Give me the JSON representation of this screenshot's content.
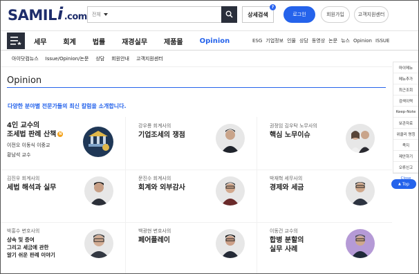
{
  "header": {
    "logo_main": "SAMIL",
    "logo_i": "i",
    "logo_dot": ".com",
    "search": {
      "category": "전체",
      "value": ""
    },
    "advanced_search": "상세검색",
    "advanced_badge": "?",
    "login": "로그인",
    "join": "회원가입",
    "customer_center": "고객지원센터"
  },
  "nav": {
    "main": [
      "세무",
      "회계",
      "법률",
      "재경실무",
      "제품몰",
      "Opinion"
    ],
    "active": "Opinion",
    "sub": [
      "ESG",
      "기업정보",
      "인물",
      "상담",
      "동영상",
      "논문",
      "뉴스",
      "Opinion",
      "ISSUE"
    ]
  },
  "tabs": [
    "아이닷컴뉴스",
    "Issue/Opinion/논문",
    "상담",
    "회원안내",
    "고객지원센터"
  ],
  "page": {
    "title": "Opinion",
    "intro": "다양한 분야별 전문가들의 최신 칼럼을 소개합니다."
  },
  "cards": [
    {
      "meta": "",
      "title": [
        "4인 교수의",
        "조세법 판례 산책"
      ],
      "badge": "N",
      "byline": [
        "이전오 이동식 이중교",
        "황남석 교수"
      ]
    },
    {
      "meta": "강우룡 회계사의",
      "title": [
        "기업조세의 쟁점"
      ]
    },
    {
      "meta": "권정임 김우탁 노무사의",
      "title": [
        "핵심 노무이슈"
      ]
    },
    {
      "meta": "김진우 회계사의",
      "title": [
        "세법 해석과 실무"
      ]
    },
    {
      "meta": "문진수 회계사의",
      "title": [
        "회계와 외부감사"
      ]
    },
    {
      "meta": "박재혁 세무사의",
      "title": [
        "경제와 세금"
      ]
    },
    {
      "meta": "박홍수 변호사의",
      "title": [
        "상속 및 증여",
        "그리고 세금에 관한",
        "알기 쉬운 판례 이야기"
      ]
    },
    {
      "meta": "백광현 변호사의",
      "title": [
        "페어플레이"
      ]
    },
    {
      "meta": "이동건 교수의",
      "title": [
        "합병 분할의",
        "실무 사례"
      ]
    }
  ],
  "rail": [
    "마이메뉴",
    "메뉴추가",
    "최근조회",
    "검색이력",
    "Keep-Note",
    "보관자료",
    "위클리 명칭",
    "족지",
    "제안하기",
    "오류신고",
    "Close"
  ],
  "top_button": "Top",
  "colors": {
    "accent": "#2563eb",
    "dark": "#2a2f3b",
    "badge": "#f3a21b"
  }
}
